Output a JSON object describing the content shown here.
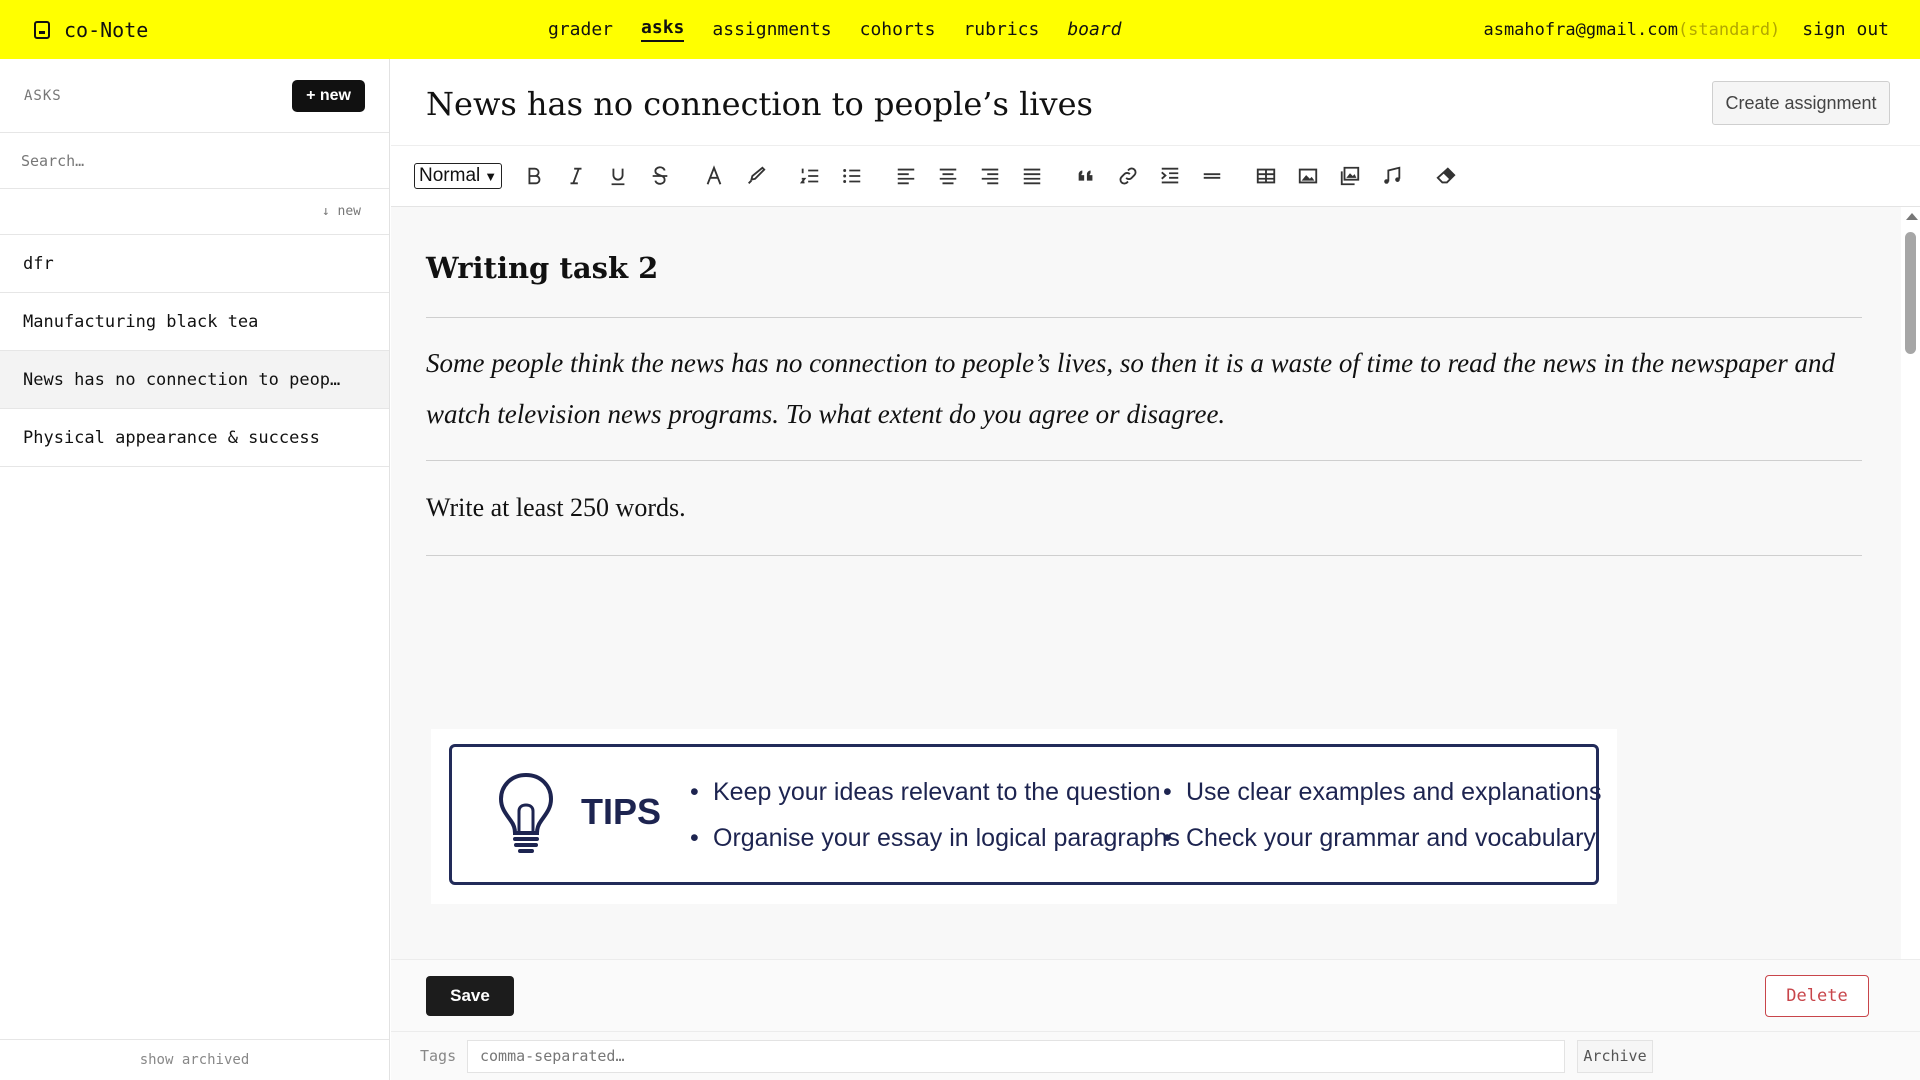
{
  "app": {
    "brand": "co-Note"
  },
  "nav": {
    "items": [
      {
        "label": "grader"
      },
      {
        "label": "asks"
      },
      {
        "label": "assignments"
      },
      {
        "label": "cohorts"
      },
      {
        "label": "rubrics"
      },
      {
        "label": "board"
      }
    ],
    "active": "asks"
  },
  "account": {
    "email": "asmahofra@gmail.com",
    "plan": "(standard)",
    "signout": "sign out"
  },
  "sidebar": {
    "title": "ASKS",
    "new_label": "+ new",
    "search_placeholder": "Search…",
    "sort_label": "↓ new",
    "items": [
      {
        "label": "dfr"
      },
      {
        "label": "Manufacturing black tea"
      },
      {
        "label": "News has no connection to peop…"
      },
      {
        "label": "Physical appearance & success"
      }
    ],
    "selected_index": 2,
    "show_archived": "show archived"
  },
  "document": {
    "title": "News has no connection to people’s lives",
    "create_assignment": "Create assignment"
  },
  "toolbar": {
    "format": "Normal",
    "icons": [
      "bold-icon",
      "italic-icon",
      "underline-icon",
      "strikethrough-icon",
      "text-color-icon",
      "highlight-icon",
      "ordered-list-icon",
      "bullet-list-icon",
      "align-left-icon",
      "align-center-icon",
      "align-right-icon",
      "align-justify-icon",
      "blockquote-icon",
      "link-icon",
      "indent-icon",
      "horizontal-rule-icon",
      "table-icon",
      "image-icon",
      "gallery-icon",
      "audio-icon",
      "clear-format-icon"
    ]
  },
  "editor": {
    "heading": "Writing task 2",
    "prompt": "Some people think the news has no connection to people’s lives, so then it is a waste of time to read the news in the newspaper and watch television news programs. To what extent do you agree or disagree.",
    "instruction": "Write at least 250 words.",
    "tips": {
      "title": "TIPS",
      "col1": [
        "Keep your ideas relevant to the question",
        "Organise your essay in logical paragraphs"
      ],
      "col2": [
        "Use clear examples and explanations",
        "Check your grammar and vocabulary"
      ]
    }
  },
  "actions": {
    "save": "Save",
    "delete": "Delete",
    "tags_label": "Tags",
    "tags_placeholder": "comma-separated…",
    "archive": "Archive"
  },
  "colors": {
    "topbar": "#ffff00",
    "delete": "#c8454a",
    "tips_navy": "#1d2450"
  }
}
